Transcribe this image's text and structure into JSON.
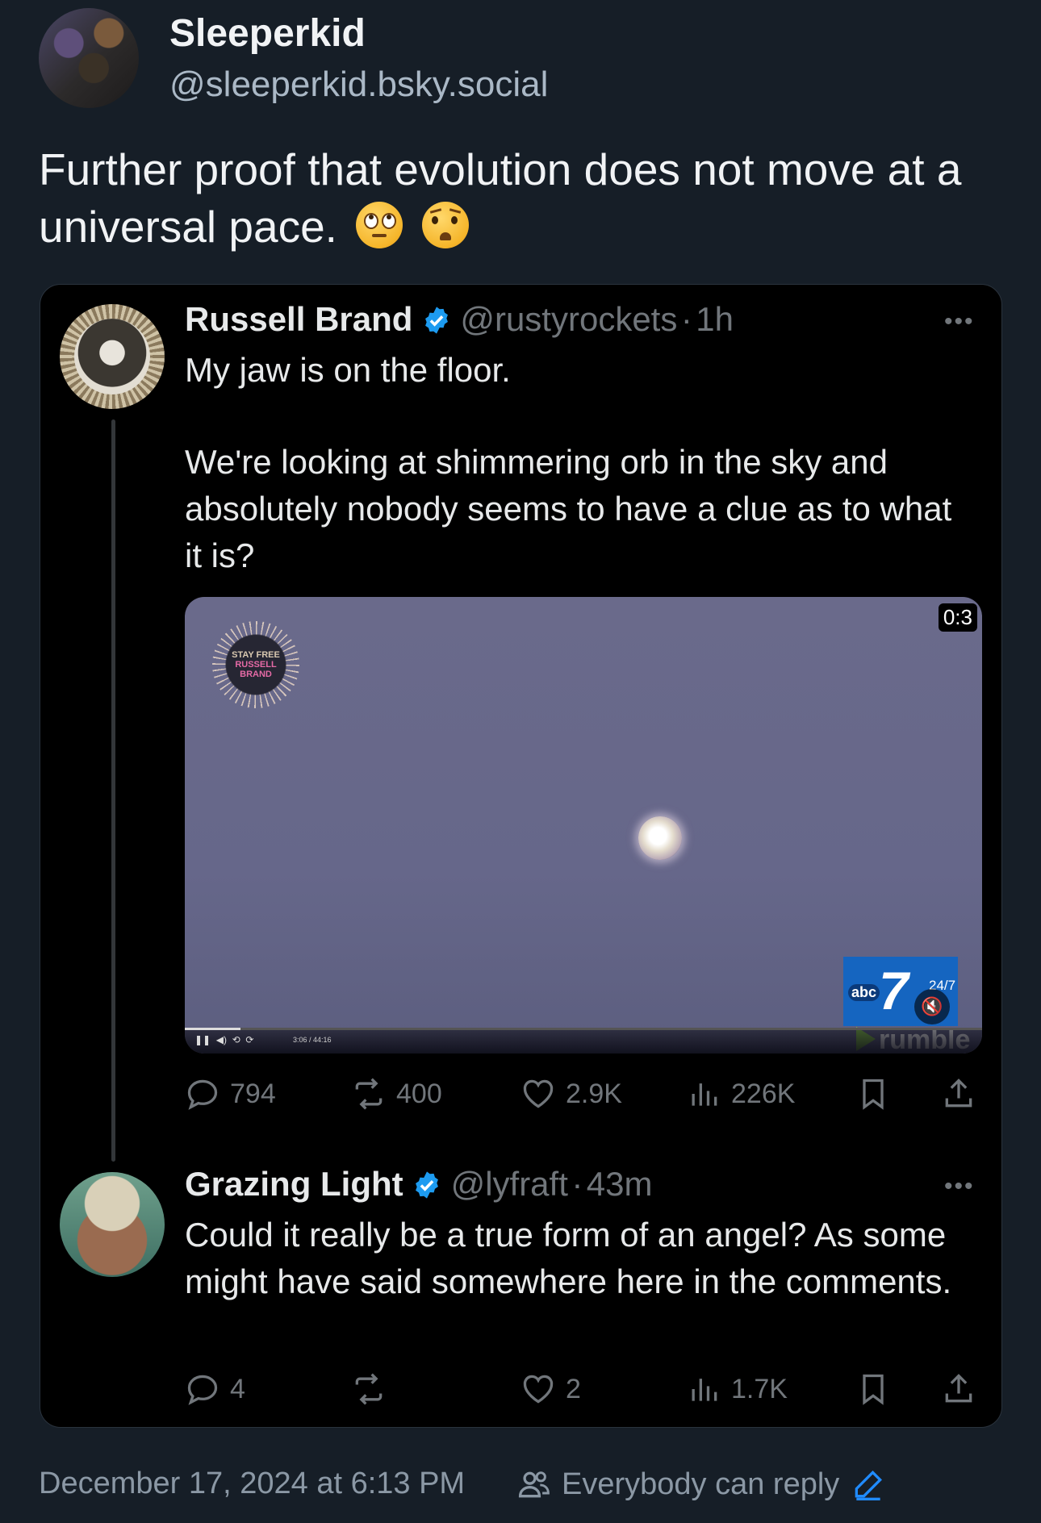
{
  "post": {
    "author_name": "Sleeperkid",
    "author_handle": "@sleeperkid.bsky.social",
    "text": "Further proof that evolution does not move at a universal pace.",
    "emojis": [
      "face-with-rolling-eyes",
      "anxious-face"
    ]
  },
  "embed": {
    "tweet": {
      "author_name": "Russell Brand",
      "handle": "@rustyrockets",
      "separator": "·",
      "time": "1h",
      "text_line1": "My jaw is on the floor.",
      "text_line2": "We're looking at shimmering orb in the sky and absolutely nobody seems to have a clue as to what it is?",
      "video": {
        "duration_badge": "0:3",
        "logo_line1": "STAY FREE",
        "logo_line2": "RUSSELL",
        "logo_line3": "BRAND",
        "player_time": "3:06 / 44:16",
        "player_progress": 0.07,
        "channel_label": "abc",
        "channel_number": "7",
        "channel_tag": "24/7",
        "platform": "rumble"
      },
      "stats": {
        "replies": "794",
        "reposts": "400",
        "likes": "2.9K",
        "views": "226K"
      }
    },
    "reply": {
      "author_name": "Grazing Light",
      "handle": "@lyfraft",
      "separator": "·",
      "time": "43m",
      "text": "Could it really be a true form of an angel? As some might have said somewhere here in the comments.",
      "stats": {
        "replies": "4",
        "reposts": "",
        "likes": "2",
        "views": "1.7K"
      }
    }
  },
  "footer": {
    "date": "December 17, 2024 at 6:13 PM",
    "reply_setting": "Everybody can reply"
  },
  "colors": {
    "background": "#161e27",
    "embed_background": "#000000",
    "verified_blue": "#1d9bf0",
    "muted": "#71767b",
    "edit_icon": "#208bfe"
  }
}
